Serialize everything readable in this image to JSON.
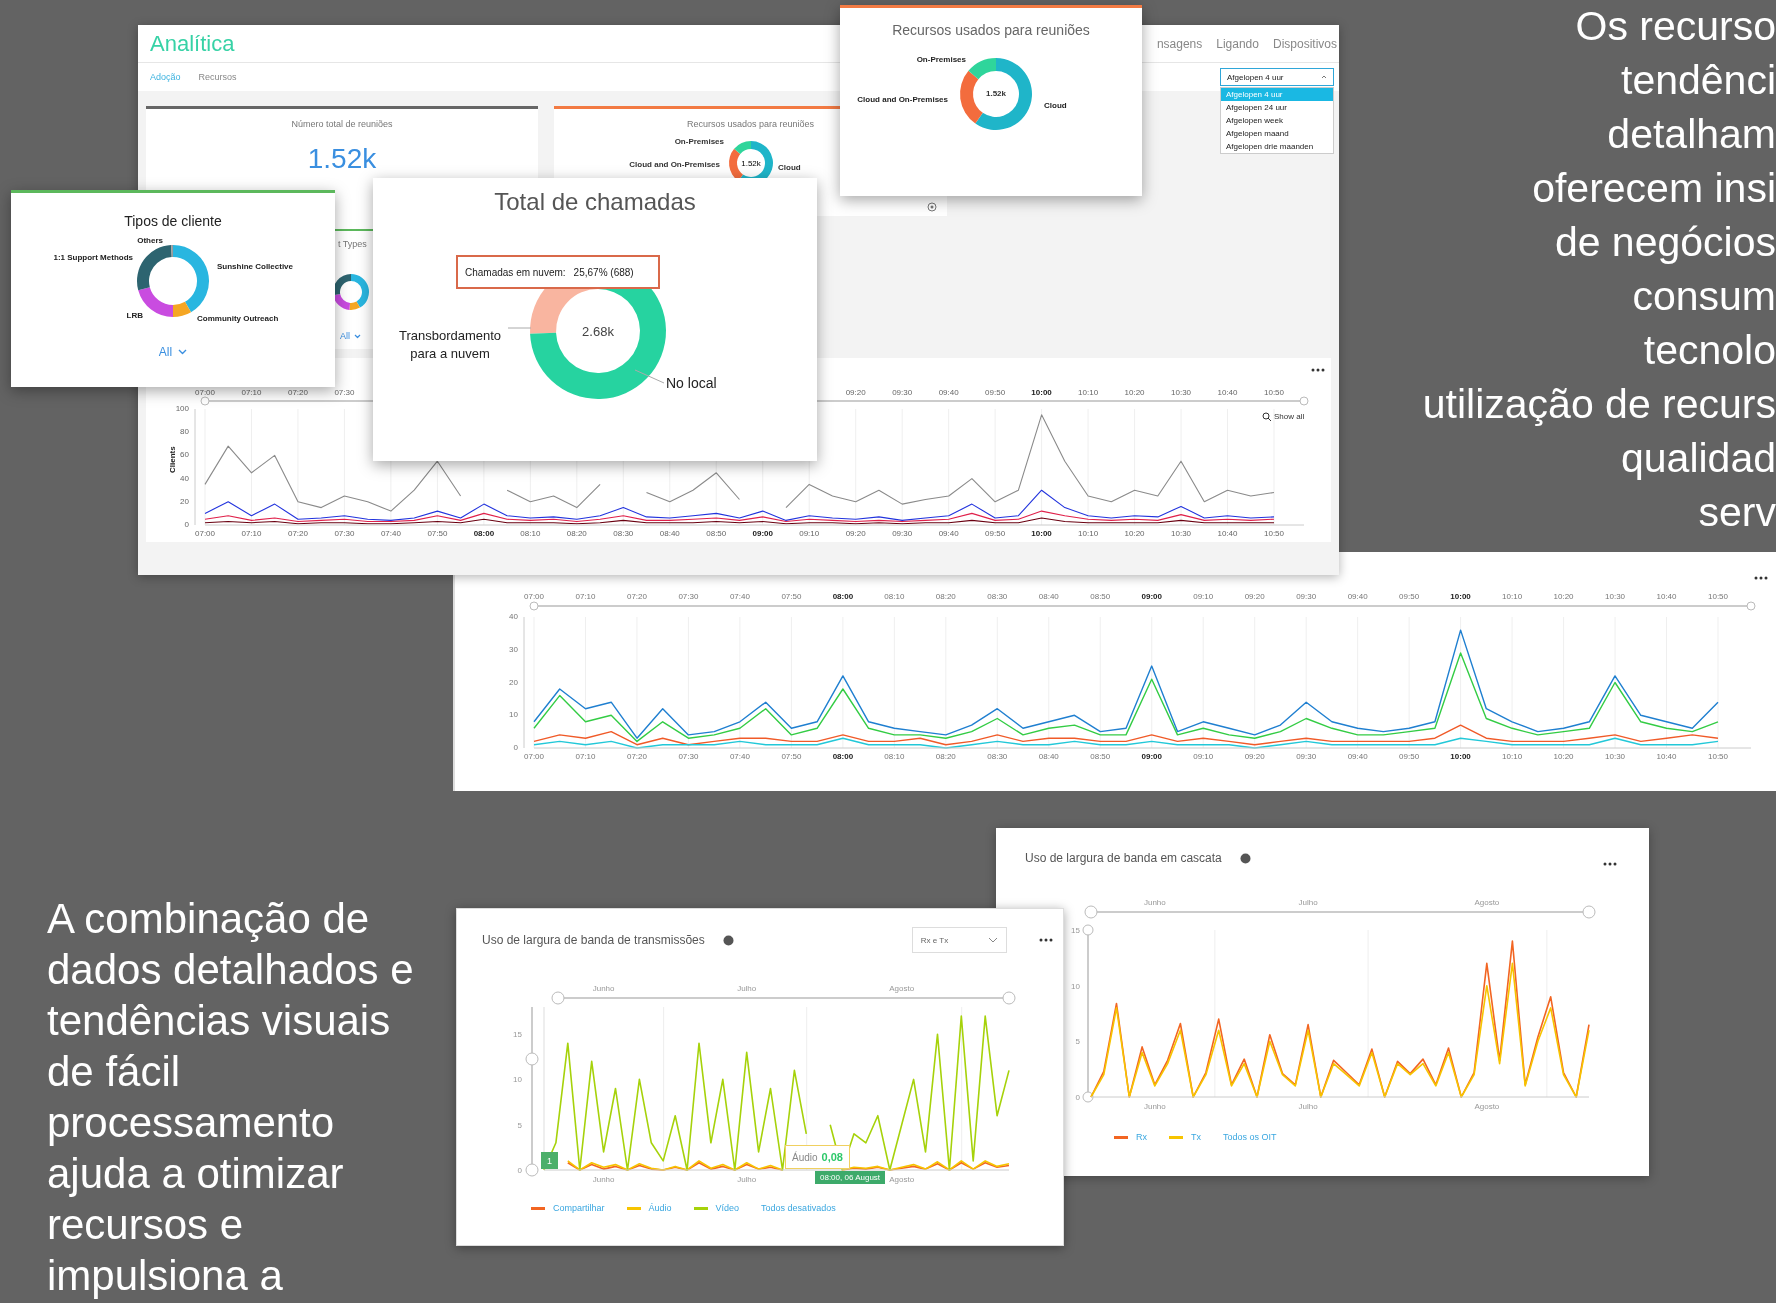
{
  "main_window": {
    "title": "Analítica",
    "nav": [
      {
        "label": "nsagens"
      },
      {
        "label": "Ligando"
      },
      {
        "label": "Dispositivos"
      }
    ],
    "tabs": [
      {
        "label": "Adoção",
        "selected": true
      },
      {
        "label": "Recursos",
        "selected": false
      }
    ],
    "time_filter": {
      "value": "Afgelopen 4 uur",
      "expanded": true,
      "options": [
        {
          "label": "Afgelopen 4 uur",
          "selected": true
        },
        {
          "label": "Afgelopen 24 uur",
          "selected": false
        },
        {
          "label": "Afgelopen week",
          "selected": false
        },
        {
          "label": "Afgelopen maand",
          "selected": false
        },
        {
          "label": "Afgelopen drie maanden",
          "selected": false
        }
      ]
    },
    "total_card": {
      "title": "Número total de reuniões",
      "value": "1.52k"
    },
    "resources_card": {
      "title": "Recursos usados para reuniões",
      "labels": [
        "On-Premises",
        "Cloud and On-Premises",
        "Cloud"
      ],
      "center": "1.52k"
    },
    "types_card": {
      "title": "t Types",
      "filter": "All"
    },
    "clients_chart": {
      "navigator_labels_left": [
        "07:00",
        "07:10",
        "07:20",
        "07:30"
      ],
      "navigator_labels_right": [
        "09:20",
        "09:30",
        "09:40",
        "09:50",
        "10:00",
        "10:10",
        "10:20",
        "10:30",
        "10:40",
        "10:50"
      ],
      "show_all": "Show all",
      "chart_data": {
        "type": "line",
        "ylabel": "Clients",
        "grid": true,
        "ylim": [
          0,
          100
        ],
        "yticks": [
          0,
          20,
          40,
          60,
          80,
          100
        ],
        "categories": [
          "07:00",
          null,
          "07:10",
          null,
          "07:20",
          null,
          "07:30",
          null,
          "07:40",
          null,
          "07:50",
          null,
          "08:00",
          null,
          "08:10",
          null,
          "08:20",
          null,
          "08:30",
          null,
          "08:40",
          null,
          "08:50",
          null,
          "09:00",
          null,
          "09:10",
          null,
          "09:20",
          null,
          "09:30",
          null,
          "09:40",
          null,
          "09:50",
          null,
          "10:00",
          null,
          "10:10",
          null,
          "10:20",
          null,
          "10:30",
          null,
          "10:40",
          null,
          "10:50"
        ],
        "series": [
          {
            "color": "#8a8a8a",
            "values": [
              35,
              68,
              45,
              60,
              20,
              15,
              25,
              20,
              12,
              30,
              55,
              25,
              null,
              30,
              20,
              25,
              15,
              35,
              null,
              28,
              20,
              30,
              45,
              22,
              null,
              15,
              35,
              25,
              20,
              30,
              18,
              22,
              25,
              40,
              20,
              30,
              95,
              55,
              25,
              20,
              30,
              25,
              55,
              20,
              30,
              25,
              28
            ]
          },
          {
            "color": "#2233dd",
            "values": [
              10,
              20,
              8,
              18,
              5,
              6,
              8,
              5,
              4,
              6,
              12,
              6,
              18,
              8,
              6,
              7,
              5,
              8,
              15,
              7,
              6,
              8,
              10,
              6,
              12,
              4,
              8,
              6,
              5,
              7,
              4,
              6,
              8,
              18,
              6,
              8,
              30,
              15,
              8,
              6,
              8,
              7,
              16,
              6,
              8,
              6,
              7
            ]
          },
          {
            "color": "#e0204a",
            "values": [
              5,
              8,
              4,
              6,
              3,
              4,
              5,
              3,
              3,
              4,
              8,
              4,
              10,
              5,
              4,
              5,
              3,
              5,
              8,
              4,
              4,
              5,
              6,
              4,
              7,
              3,
              5,
              4,
              3,
              4,
              3,
              4,
              5,
              10,
              4,
              5,
              12,
              8,
              5,
              4,
              5,
              4,
              9,
              4,
              5,
              4,
              5
            ]
          },
          {
            "color": "#6a0010",
            "values": [
              2,
              3,
              2,
              3,
              1,
              2,
              2,
              1,
              1,
              2,
              3,
              2,
              5,
              2,
              2,
              2,
              1,
              2,
              4,
              2,
              2,
              2,
              3,
              2,
              3,
              1,
              2,
              2,
              1,
              2,
              1,
              2,
              2,
              4,
              2,
              2,
              6,
              3,
              2,
              2,
              2,
              2,
              4,
              2,
              2,
              2,
              2
            ]
          }
        ]
      }
    }
  },
  "resources_popup": {
    "title": "Recursos usados para reuniões",
    "labels": [
      "On-Premises",
      "Cloud and On-Premises",
      "Cloud"
    ],
    "center": "1.52k"
  },
  "client_types": {
    "title": "Tipos de cliente",
    "labels": [
      "Others",
      "1:1 Support Methods",
      "Sunshine Collective",
      "LRB",
      "Community Outreach"
    ],
    "filter": "All"
  },
  "calls": {
    "title": "Total de chamadas",
    "tooltip_label": "Chamadas em nuvem:",
    "tooltip_value": "25,67% (688)",
    "center": "2.68k",
    "chart_data": {
      "type": "donut",
      "categories": [
        "Transbordamento para a nuvem",
        "No local"
      ],
      "values": [
        25.67,
        74.33
      ]
    }
  },
  "meetings_chart": {
    "navigator_labels": [
      "07:00",
      "07:10",
      "07:20",
      "07:30",
      "07:40",
      "07:50",
      "08:00",
      "08:10",
      "08:20",
      "08:30",
      "08:40",
      "08:50",
      "09:00",
      "09:10",
      "09:20",
      "09:30",
      "09:40",
      "09:50",
      "10:00",
      "10:10",
      "10:20",
      "10:30",
      "10:40",
      "10:50"
    ],
    "chart_data": {
      "type": "line",
      "grid": true,
      "ylim": [
        0,
        40
      ],
      "yticks": [
        0,
        10,
        20,
        30,
        40
      ],
      "categories": [
        "07:00",
        null,
        "07:10",
        null,
        "07:20",
        null,
        "07:30",
        null,
        "07:40",
        null,
        "07:50",
        null,
        "08:00",
        null,
        "08:10",
        null,
        "08:20",
        null,
        "08:30",
        null,
        "08:40",
        null,
        "08:50",
        null,
        "09:00",
        null,
        "09:10",
        null,
        "09:20",
        null,
        "09:30",
        null,
        "09:40",
        null,
        "09:50",
        null,
        "10:00",
        null,
        "10:10",
        null,
        "10:20",
        null,
        "10:30",
        null,
        "10:40",
        null,
        "10:50"
      ],
      "series": [
        {
          "color": "#1f7fd0",
          "values": [
            8,
            18,
            12,
            14,
            3,
            12,
            4,
            5,
            8,
            14,
            6,
            8,
            22,
            8,
            6,
            5,
            4,
            7,
            12,
            6,
            8,
            10,
            5,
            6,
            25,
            5,
            8,
            6,
            4,
            7,
            14,
            8,
            6,
            5,
            6,
            8,
            36,
            12,
            8,
            5,
            6,
            8,
            22,
            10,
            8,
            6,
            14
          ]
        },
        {
          "color": "#33cc44",
          "values": [
            6,
            16,
            8,
            10,
            2,
            8,
            3,
            4,
            6,
            12,
            4,
            6,
            18,
            6,
            4,
            4,
            3,
            5,
            9,
            4,
            6,
            7,
            4,
            4,
            21,
            4,
            6,
            4,
            3,
            5,
            9,
            6,
            4,
            4,
            5,
            6,
            29,
            9,
            6,
            4,
            5,
            6,
            20,
            8,
            6,
            5,
            8
          ]
        },
        {
          "color": "#f05a28",
          "values": [
            2,
            4,
            3,
            5,
            1,
            3,
            1,
            2,
            3,
            3,
            2,
            2,
            4,
            2,
            2,
            3,
            1,
            2,
            4,
            2,
            3,
            3,
            2,
            2,
            4,
            2,
            3,
            2,
            1,
            2,
            3,
            2,
            2,
            2,
            2,
            3,
            7,
            3,
            2,
            2,
            2,
            3,
            4,
            2,
            3,
            4,
            3
          ]
        },
        {
          "color": "#22c8d8",
          "values": [
            1,
            2,
            1,
            2,
            0,
            1,
            1,
            1,
            2,
            1,
            1,
            1,
            3,
            1,
            1,
            1,
            0,
            1,
            2,
            1,
            1,
            2,
            1,
            1,
            2,
            1,
            1,
            1,
            0,
            1,
            2,
            1,
            1,
            1,
            1,
            1,
            3,
            2,
            1,
            1,
            1,
            1,
            3,
            1,
            1,
            1,
            2
          ]
        }
      ]
    }
  },
  "headline": {
    "lines": [
      "Os recurso",
      "tendênci",
      "detalham",
      "oferecem insi",
      "de negócios",
      "consum",
      "tecnolo",
      "utilização de recurs",
      "qualidad",
      "serv"
    ]
  },
  "body_text": {
    "lines": [
      "A combinação de",
      "dados detalhados e",
      "tendências visuais",
      "de fácil",
      "processamento",
      "ajuda a otimizar",
      "recursos e",
      "impulsiona a"
    ]
  },
  "cascade_panel": {
    "title": "Uso de largura de banda em cascata",
    "navigator_labels": [
      "Junho",
      "Julho",
      "Agosto"
    ],
    "toggle_all": "Todos os OIT",
    "chart_data": {
      "type": "line",
      "grid": true,
      "ylim": [
        0,
        15
      ],
      "yticks": [
        0,
        5,
        10,
        15
      ],
      "categories": [
        null,
        null,
        null,
        null,
        null,
        "Junho",
        null,
        null,
        null,
        null,
        null,
        null,
        null,
        null,
        null,
        null,
        null,
        "Julho",
        null,
        null,
        null,
        null,
        null,
        null,
        null,
        null,
        null,
        null,
        null,
        null,
        null,
        "Agosto",
        null,
        null,
        null,
        null,
        null,
        null,
        null,
        null
      ],
      "series": [
        {
          "name": "Rx",
          "color": "#f26522",
          "values": [
            0,
            2.3,
            8.4,
            0,
            4.5,
            1.1,
            3.3,
            6.6,
            0,
            2.2,
            7,
            1.1,
            3.4,
            0,
            5.6,
            2.1,
            1.1,
            6.5,
            0,
            3.3,
            2.2,
            1.1,
            4.3,
            0,
            3.2,
            2.1,
            3.4,
            1.1,
            4.4,
            0,
            2.2,
            12,
            3.3,
            14,
            1.1,
            5.4,
            9,
            2.2,
            0,
            6.5
          ]
        },
        {
          "name": "Tx",
          "color": "#f7c400",
          "values": [
            0,
            2,
            8,
            0,
            4,
            1,
            3,
            6,
            0,
            2,
            6,
            1,
            3,
            0,
            5,
            2,
            1,
            6,
            0,
            3,
            2,
            1,
            4,
            0,
            3,
            2,
            3,
            1,
            4,
            0,
            2,
            10,
            3,
            12,
            1,
            5,
            8,
            2,
            0,
            6
          ]
        }
      ]
    }
  },
  "transmission_panel": {
    "title": "Uso de largura de banda de transmissões",
    "dropdown": "Rx e Tx",
    "navigator_labels": [
      "Junho",
      "Julho",
      "Agosto"
    ],
    "marker": "1",
    "tooltip": {
      "label": "Áudio",
      "value": "0,08"
    },
    "time_label": "08:00, 06 August",
    "toggle_all": "Todos desativados",
    "chart_data": {
      "type": "line",
      "grid": true,
      "ylim": [
        0,
        18
      ],
      "yticks": [
        0,
        5,
        10,
        15
      ],
      "categories": [
        null,
        null,
        null,
        null,
        null,
        "Junho",
        null,
        null,
        null,
        null,
        null,
        null,
        null,
        null,
        null,
        null,
        null,
        "Julho",
        null,
        null,
        null,
        null,
        null,
        null,
        null,
        null,
        null,
        null,
        null,
        null,
        "Agosto",
        null,
        null,
        null,
        null,
        null,
        null,
        null,
        null,
        null
      ],
      "series": [
        {
          "name": "Compartilhar",
          "color": "#f26522",
          "values": [
            null,
            null,
            0.8,
            0,
            0.6,
            0.1,
            0.4,
            0,
            0.5,
            0.1,
            0,
            0.3,
            0,
            0.8,
            0.1,
            0.4,
            0,
            0.6,
            0.1,
            0.3,
            0,
            null,
            null,
            null,
            null,
            0,
            0.2,
            0.1,
            0.3,
            0,
            0.2,
            0.4,
            0.1,
            0.7,
            0,
            0.8,
            0.1,
            0.8,
            0.3,
            0.5
          ]
        },
        {
          "name": "Áudio",
          "color": "#f7c400",
          "values": [
            null,
            null,
            1,
            0,
            0.8,
            0.3,
            0.6,
            0,
            0.7,
            0.2,
            0,
            0.4,
            0,
            1,
            0.2,
            0.6,
            0,
            0.8,
            0.1,
            0.5,
            0,
            null,
            null,
            null,
            null,
            0,
            0.3,
            0.2,
            0.4,
            0,
            0.3,
            0.6,
            0.1,
            0.9,
            0,
            1,
            0.1,
            1,
            0.4,
            0.7
          ]
        },
        {
          "name": "Vídeo",
          "color": "#a6d20a",
          "values": [
            0,
            3,
            14,
            0,
            12,
            2,
            9,
            0,
            10,
            3,
            1,
            6,
            0,
            14,
            3,
            10,
            0,
            13,
            2,
            9,
            0,
            11,
            4,
            null,
            5,
            0,
            4,
            3,
            6,
            0,
            5,
            10,
            2,
            15,
            0,
            17,
            1,
            17,
            6,
            11
          ]
        }
      ]
    }
  }
}
